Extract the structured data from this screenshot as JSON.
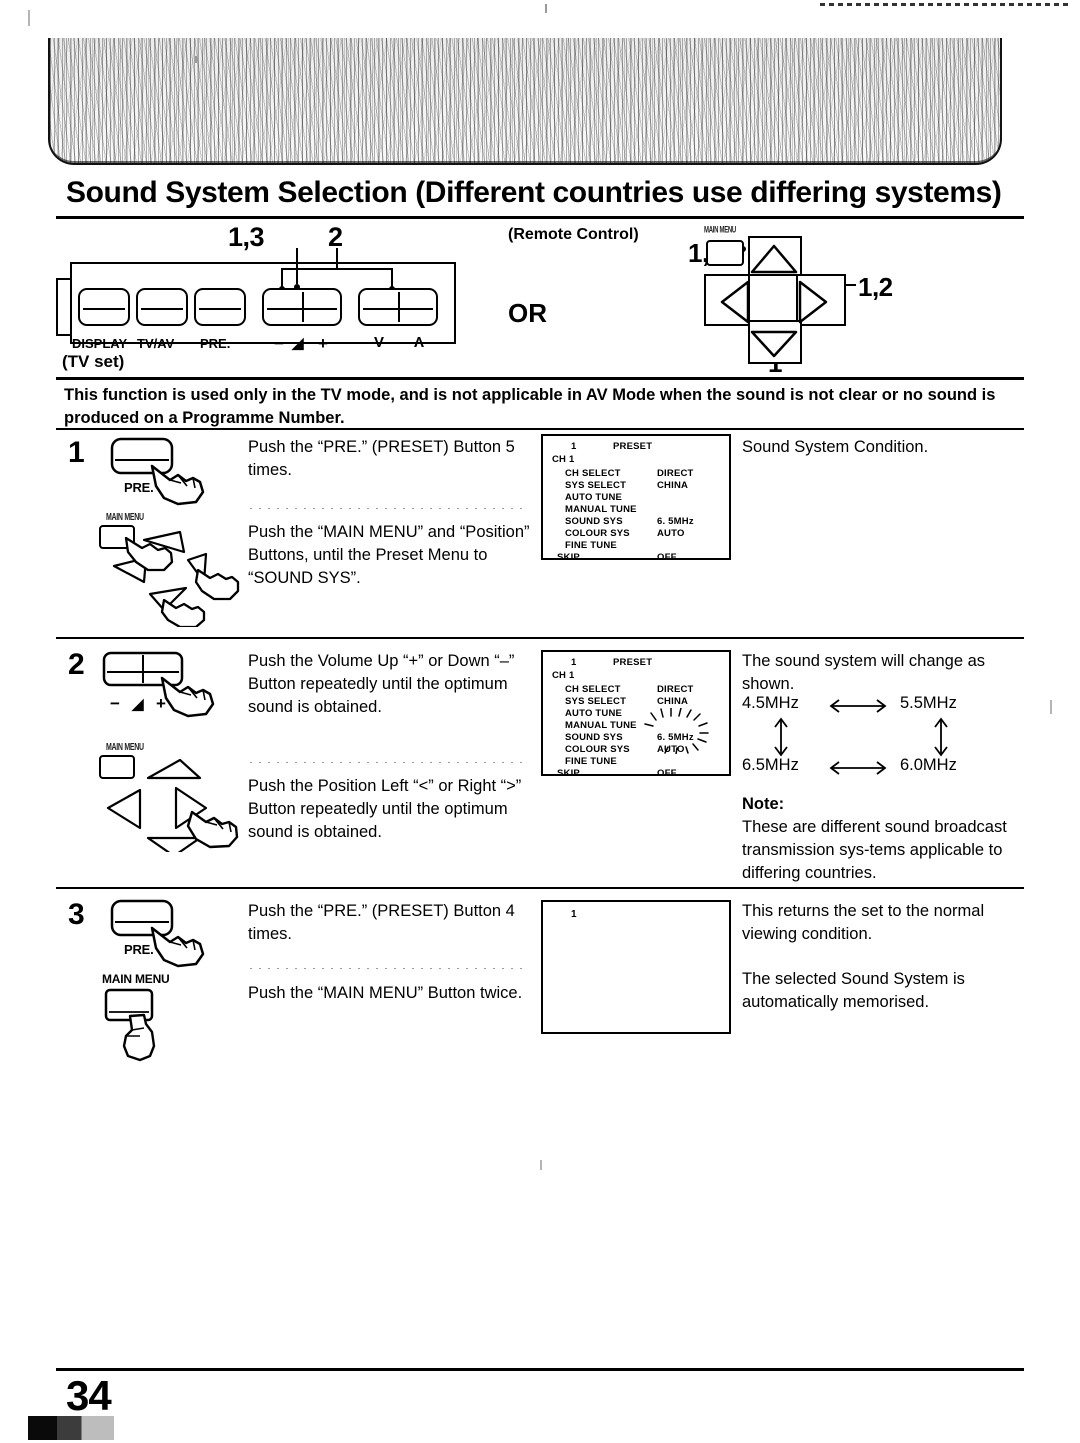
{
  "page": {
    "title": "Sound System Selection (Different countries use differing systems)",
    "page_number": "34",
    "intro": "This function is used only in the TV mode, and is not applicable in AV Mode when the sound is not clear or no sound is produced on a Programme Number."
  },
  "diagram": {
    "tv_set_label": "(TV set)",
    "remote_label": "(Remote Control)",
    "or_label": "OR",
    "tv_callouts": {
      "pre": "1,3",
      "volume": "2"
    },
    "remote_callouts": {
      "main_menu": "1,3",
      "right": "1,2",
      "down": "1"
    },
    "tv_buttons": [
      {
        "label": "DISPLAY"
      },
      {
        "label": "TV/AV"
      },
      {
        "label": "PRE."
      },
      {
        "label": "−"
      },
      {
        "label": "◢"
      },
      {
        "label": "+"
      },
      {
        "label": "V"
      },
      {
        "label": "Λ"
      }
    ],
    "remote_main_menu_label": "MAIN MENU"
  },
  "steps": [
    {
      "number": "1",
      "instructions": [
        "Push the “PRE.” (PRESET) Button 5 times.",
        "Push the “MAIN MENU” and “Position” Buttons, until the Preset Menu to “SOUND SYS”."
      ],
      "pictogram_labels": {
        "top": "PRE.",
        "bottom": "MAIN MENU"
      },
      "result": "Sound System Condition."
    },
    {
      "number": "2",
      "instructions": [
        "Push the Volume Up “+” or Down “–” Button repeatedly until the optimum sound is obtained.",
        "Push the Position Left “<” or Right “>” Button repeatedly until the optimum sound is obtained."
      ],
      "pictogram_labels": {
        "top_minus": "−",
        "top_icon": "◢",
        "top_plus": "+",
        "bottom": "MAIN MENU"
      },
      "result": "The sound system will change as shown.",
      "note_heading": "Note:",
      "note_body": "These are different sound broadcast transmission sys-tems applicable to differing countries."
    },
    {
      "number": "3",
      "instructions": [
        "Push the “PRE.” (PRESET) Button 4 times.",
        "Push the “MAIN MENU” Button twice."
      ],
      "pictogram_labels": {
        "top": "PRE.",
        "bottom": "MAIN MENU"
      },
      "result": "This returns the set to the normal viewing condition.",
      "result2": "The selected Sound System is automatically memorised."
    }
  ],
  "osd_screens": [
    {
      "id": "step1",
      "number": "1",
      "title": "PRESET",
      "channel": "CH  1",
      "rows": [
        {
          "key": "CH  SELECT",
          "value": "DIRECT"
        },
        {
          "key": "SYS SELECT",
          "value": "CHINA"
        },
        {
          "key": "AUTO  TUNE",
          "value": ""
        },
        {
          "key": "MANUAL TUNE",
          "value": ""
        },
        {
          "key": "SOUND  SYS",
          "value": "6. 5MHz"
        },
        {
          "key": "COLOUR SYS",
          "value": "AUTO"
        },
        {
          "key": "FINE TUNE",
          "value": ""
        },
        {
          "key": "SKIP",
          "value": "OFF"
        }
      ],
      "highlight": ""
    },
    {
      "id": "step2",
      "number": "1",
      "title": "PRESET",
      "channel": "CH  1",
      "rows": [
        {
          "key": "CH  SELECT",
          "value": "DIRECT"
        },
        {
          "key": "SYS SELECT",
          "value": "CHINA"
        },
        {
          "key": "AUTO  TUNE",
          "value": ""
        },
        {
          "key": "MANUAL TUNE",
          "value": ""
        },
        {
          "key": "SOUND  SYS",
          "value": "6. 5MHz"
        },
        {
          "key": "COLOUR SYS",
          "value": "AUTO"
        },
        {
          "key": "FINE TUNE",
          "value": ""
        },
        {
          "key": "SKIP",
          "value": "OFF"
        }
      ],
      "highlight": "SOUND SYS value flashing"
    },
    {
      "id": "step3",
      "number": "1",
      "title": "",
      "channel": "",
      "rows": [],
      "highlight": ""
    }
  ],
  "frequency_cycle": {
    "top_left": "4.5MHz",
    "top_right": "5.5MHz",
    "bottom_left": "6.5MHz",
    "bottom_right": "6.0MHz"
  }
}
